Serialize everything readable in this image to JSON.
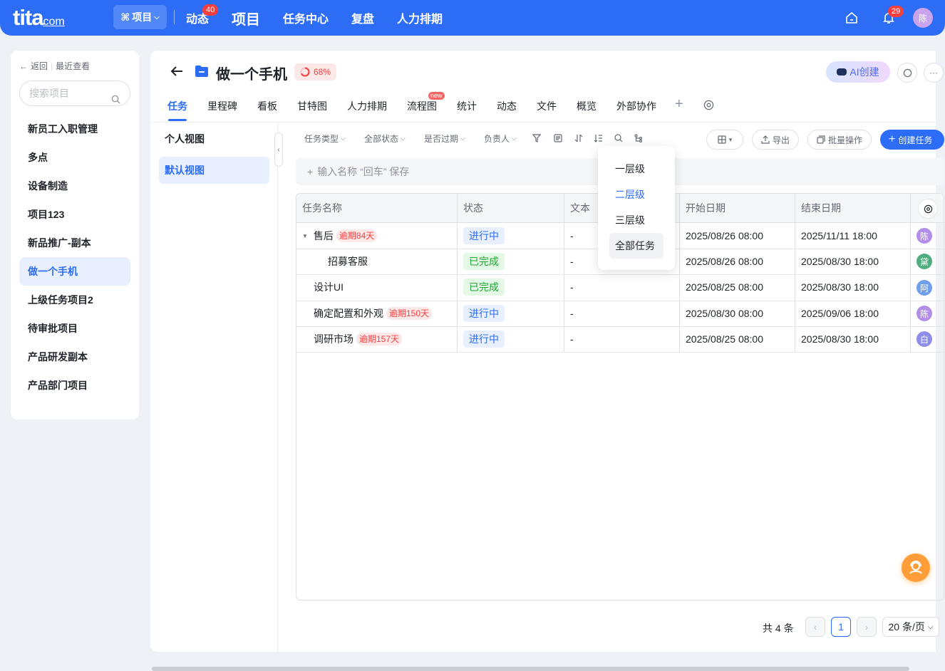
{
  "topbar": {
    "logo": "tita",
    "logo_suffix": "com",
    "project_switch": "项目",
    "nav": [
      {
        "label": "动态",
        "badge": "40"
      },
      {
        "label": "项目"
      },
      {
        "label": "任务中心"
      },
      {
        "label": "复盘"
      },
      {
        "label": "人力排期"
      }
    ],
    "notification_badge": "29",
    "user_avatar": "陈"
  },
  "left": {
    "back": "返回",
    "recent": "最近查看",
    "search_placeholder": "搜索项目",
    "projects": [
      "新员工入职管理",
      "多点",
      "设备制造",
      "项目123",
      "新品推广-副本",
      "做一个手机",
      "上级任务项目2",
      "待审批项目",
      "产品研发副本",
      "产品部门项目"
    ],
    "selected_index": 5
  },
  "project": {
    "title": "做一个手机",
    "progress": "68%",
    "progress_value": 0.68,
    "ai_button": "AI创建",
    "tabs": [
      "任务",
      "里程碑",
      "看板",
      "甘特图",
      "人力排期",
      "流程图",
      "统计",
      "动态",
      "文件",
      "概览",
      "外部协作"
    ],
    "new_badge": "new"
  },
  "views": {
    "personal": "个人视图",
    "default": "默认视图"
  },
  "toolbar": {
    "filters": [
      "任务类型",
      "全部状态",
      "是否过期",
      "负责人"
    ],
    "export": "导出",
    "batch": "批量操作",
    "create": "创建任务",
    "quickadd_placeholder": "输入名称 “回车” 保存"
  },
  "table": {
    "columns": [
      "任务名称",
      "状态",
      "文本",
      "开始日期",
      "结束日期"
    ],
    "rows": [
      {
        "name": "售后",
        "overdue": "逾期84天",
        "status": "进行中",
        "status_kind": "prog",
        "text": "-",
        "start": "2025/08/26 08:00",
        "end": "2025/11/11 18:00",
        "owner": "陈",
        "owner_color": "#b38ee8",
        "level": 0,
        "expanded": true
      },
      {
        "name": "招募客服",
        "overdue": "",
        "status": "已完成",
        "status_kind": "done",
        "text": "-",
        "start": "2025/08/26 08:00",
        "end": "2025/08/30 18:00",
        "owner": "黛",
        "owner_color": "#4fae7f",
        "level": 1
      },
      {
        "name": "设计UI",
        "overdue": "",
        "status": "已完成",
        "status_kind": "done",
        "text": "-",
        "start": "2025/08/25 08:00",
        "end": "2025/08/30 18:00",
        "owner": "阿",
        "owner_color": "#6f9fe8",
        "level": 0
      },
      {
        "name": "确定配置和外观",
        "overdue": "逾期150天",
        "status": "进行中",
        "status_kind": "prog",
        "text": "-",
        "start": "2025/08/30 08:00",
        "end": "2025/09/06 18:00",
        "owner": "陈",
        "owner_color": "#b38ee8",
        "level": 0
      },
      {
        "name": "调研市场",
        "overdue": "逾期157天",
        "status": "进行中",
        "status_kind": "prog",
        "text": "-",
        "start": "2025/08/25 08:00",
        "end": "2025/08/30 18:00",
        "owner": "白",
        "owner_color": "#8e8ee8",
        "level": 0
      }
    ]
  },
  "level_dropdown": {
    "items": [
      "一层级",
      "二层级",
      "三层级",
      "全部任务"
    ],
    "selected_index": 1,
    "hover_index": 3
  },
  "pagination": {
    "total": "共 4 条",
    "current": "1",
    "page_size": "20 条/页"
  },
  "colors": {
    "primary": "#2d6df6",
    "danger": "#f53f3f",
    "success": "#23a139"
  }
}
